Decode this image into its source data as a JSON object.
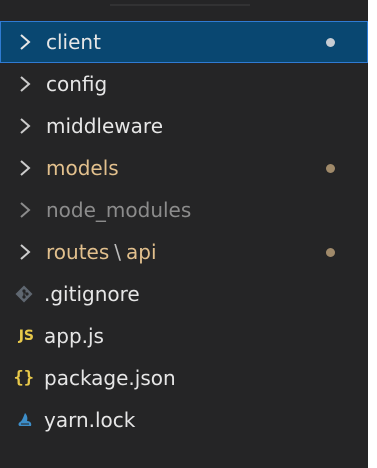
{
  "explorer": {
    "items": [
      {
        "label": "client",
        "kind": "folder",
        "selected": true,
        "modified": true
      },
      {
        "label": "config",
        "kind": "folder"
      },
      {
        "label": "middleware",
        "kind": "folder"
      },
      {
        "label": "models",
        "kind": "folder",
        "modified": true
      },
      {
        "label": "node_modules",
        "kind": "folder",
        "dimmed": true
      },
      {
        "label_part1": "routes",
        "separator": "\\",
        "label_part2": "api",
        "kind": "folder",
        "modified": true
      },
      {
        "label": ".gitignore",
        "kind": "file",
        "icon": "git-icon"
      },
      {
        "label": "app.js",
        "kind": "file",
        "icon": "js-icon",
        "icon_text": "JS"
      },
      {
        "label": "package.json",
        "kind": "file",
        "icon": "json-braces-icon",
        "icon_text": "{}"
      },
      {
        "label": "yarn.lock",
        "kind": "file",
        "icon": "yarn-icon"
      }
    ]
  },
  "colors": {
    "background": "#252526",
    "selection": "#094771",
    "selection_border": "#2f7bd3",
    "modified_text": "#e2c08d",
    "dimmed_text": "#8c8c8c",
    "js_yellow": "#e8c94a"
  }
}
